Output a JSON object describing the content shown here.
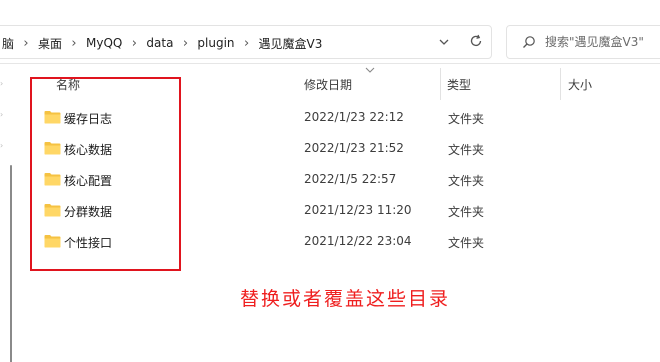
{
  "breadcrumb": {
    "items": [
      "脑",
      "桌面",
      "MyQQ",
      "data",
      "plugin",
      "遇见魔盒V3"
    ]
  },
  "search": {
    "placeholder": "搜索\"遇见魔盒V3\""
  },
  "columns": {
    "name": "名称",
    "date": "修改日期",
    "type": "类型",
    "size": "大小"
  },
  "files": [
    {
      "name": "缓存日志",
      "date": "2022/1/23 22:12",
      "type": "文件夹"
    },
    {
      "name": "核心数据",
      "date": "2022/1/23 21:52",
      "type": "文件夹"
    },
    {
      "name": "核心配置",
      "date": "2022/1/5 22:57",
      "type": "文件夹"
    },
    {
      "name": "分群数据",
      "date": "2021/12/23 11:20",
      "type": "文件夹"
    },
    {
      "name": "个性接口",
      "date": "2021/12/22 23:04",
      "type": "文件夹"
    }
  ],
  "annotation": {
    "text": "替换或者覆盖这些目录",
    "color": "#ef1f1f"
  },
  "colors": {
    "folder": "#f5c242",
    "highlight_border": "#e0141e"
  },
  "icons": {
    "dropdown": "chevron-down-icon",
    "refresh": "refresh-icon",
    "search": "search-icon",
    "folder": "folder-icon"
  }
}
